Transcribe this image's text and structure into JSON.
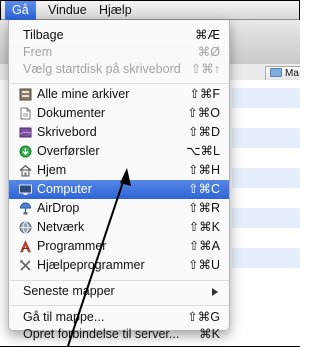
{
  "menubar": {
    "items": [
      {
        "label": "Gå",
        "active": true
      },
      {
        "label": "Vindue",
        "active": false
      },
      {
        "label": "Hjælp",
        "active": false
      }
    ]
  },
  "background_window": {
    "folder_button_label": "Ma"
  },
  "menu": {
    "groups": [
      [
        {
          "label": "Tilbage",
          "shortcut": "⌘Æ",
          "enabled": true
        },
        {
          "label": "Frem",
          "shortcut": "⌘Ø",
          "enabled": false
        },
        {
          "label": "Vælg startdisk på skrivebord",
          "shortcut": "⇧⌘↑",
          "enabled": false
        }
      ],
      [
        {
          "label": "Alle mine arkiver",
          "shortcut": "⇧⌘F",
          "icon": "all-my-files-icon",
          "enabled": true
        },
        {
          "label": "Dokumenter",
          "shortcut": "⇧⌘O",
          "icon": "documents-icon",
          "enabled": true
        },
        {
          "label": "Skrivebord",
          "shortcut": "⇧⌘D",
          "icon": "desktop-icon",
          "enabled": true
        },
        {
          "label": "Overførsler",
          "shortcut": "⌥⌘L",
          "icon": "downloads-icon",
          "enabled": true
        },
        {
          "label": "Hjem",
          "shortcut": "⇧⌘H",
          "icon": "home-icon",
          "enabled": true
        },
        {
          "label": "Computer",
          "shortcut": "⇧⌘C",
          "icon": "computer-icon",
          "enabled": true,
          "highlighted": true
        },
        {
          "label": "AirDrop",
          "shortcut": "⇧⌘R",
          "icon": "airdrop-icon",
          "enabled": true
        },
        {
          "label": "Netværk",
          "shortcut": "⇧⌘K",
          "icon": "network-icon",
          "enabled": true
        },
        {
          "label": "Programmer",
          "shortcut": "⇧⌘A",
          "icon": "applications-icon",
          "enabled": true
        },
        {
          "label": "Hjælpeprogrammer",
          "shortcut": "⇧⌘U",
          "icon": "utilities-icon",
          "enabled": true
        }
      ],
      [
        {
          "label": "Seneste mapper",
          "submenu": true,
          "enabled": true
        }
      ],
      [
        {
          "label": "Gå til mappe...",
          "shortcut": "⇧⌘G",
          "enabled": true
        },
        {
          "label": "Opret forbindelse til server...",
          "shortcut": "⌘K",
          "enabled": true
        }
      ]
    ]
  },
  "colors": {
    "highlight": "#2e63d6",
    "menubar_active": "#2a62d8",
    "disabled_text": "#a3a3a3"
  }
}
